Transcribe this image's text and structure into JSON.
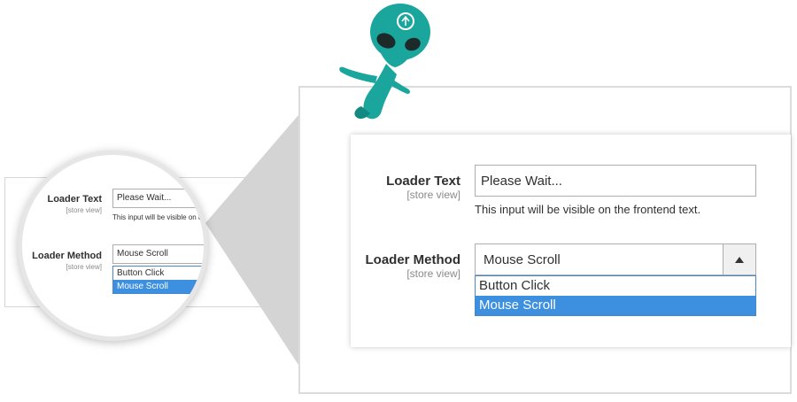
{
  "form": {
    "loader_text_label": "Loader Text",
    "loader_text_scope": "[store view]",
    "loader_text_value": "Please Wait...",
    "loader_text_note": "This input will be visible on the frontend text.",
    "loader_method_label": "Loader Method",
    "loader_method_scope": "[store view]",
    "loader_method_value": "Mouse Scroll",
    "loader_method_options": [
      "Button Click",
      "Mouse Scroll"
    ]
  },
  "magnified": {
    "loader_text_note_partial": "This input will be visible on th",
    "loader_text_value_partial": "Please Wait..."
  },
  "icons": {
    "dropdown": "triangle-up-icon",
    "mascot": "alien-mascot"
  },
  "colors": {
    "selected_option": "#3d8fe0",
    "mascot": "#1aa69c"
  }
}
